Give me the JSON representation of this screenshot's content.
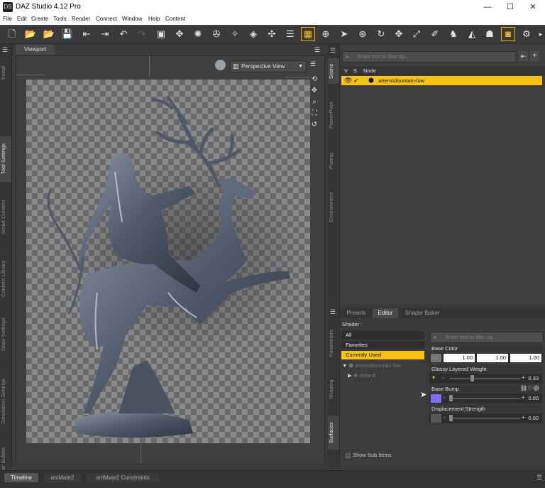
{
  "window": {
    "title": "DAZ Studio 4.12 Pro",
    "app_icon": "DS",
    "minimize": "—",
    "maximize": "☐",
    "close": "✕"
  },
  "menu": [
    "File",
    "Edit",
    "Create",
    "Tools",
    "Render",
    "Connect",
    "Window",
    "Help",
    "Content"
  ],
  "viewport": {
    "tab_label": "Viewport",
    "camera": "Perspective View"
  },
  "left_tabs": [
    "Install",
    "Tool Settings",
    "Smart Content",
    "Content Library",
    "Draw Settings",
    "Simulation Settings",
    "Shader Builder"
  ],
  "right_tabs_top": [
    "Scene",
    "PowerPose",
    "Posing",
    "Environment"
  ],
  "right_tabs_bottom": [
    "Parameters",
    "Shaping",
    "Surfaces"
  ],
  "scene": {
    "filter_placeholder": "Enter text to filter by...",
    "columns": [
      "V",
      "S",
      "Node"
    ],
    "node": "artemisfountain-low"
  },
  "surfaces": {
    "tabs": [
      "Presets",
      "Editor",
      "Shader Baker"
    ],
    "shader_label": "Shader :",
    "menu": [
      "All",
      "Favorites",
      "Currently Used"
    ],
    "tree_root": "artemisfountain-low",
    "tree_child": "default",
    "show_sub_items": "Show Sub Items",
    "filter_placeholder": "Enter text to filter by...",
    "props": {
      "base_color": {
        "label": "Base Color",
        "values": [
          "1.00",
          "1.00",
          "1.00"
        ]
      },
      "glossy": {
        "label": "Glossy Layered Weight",
        "value": "0.33"
      },
      "bump": {
        "label": "Base Bump",
        "value": "0.00"
      },
      "displacement": {
        "label": "Displacement Strength",
        "value": "0.00"
      }
    }
  },
  "bottom_tabs": [
    "Timeline",
    "aniMate2",
    "aniMate2 Constraints"
  ],
  "colors": {
    "accent": "#f6c313",
    "bump_swatch": "#7b6ef0",
    "panel": "#3c3c3c"
  }
}
